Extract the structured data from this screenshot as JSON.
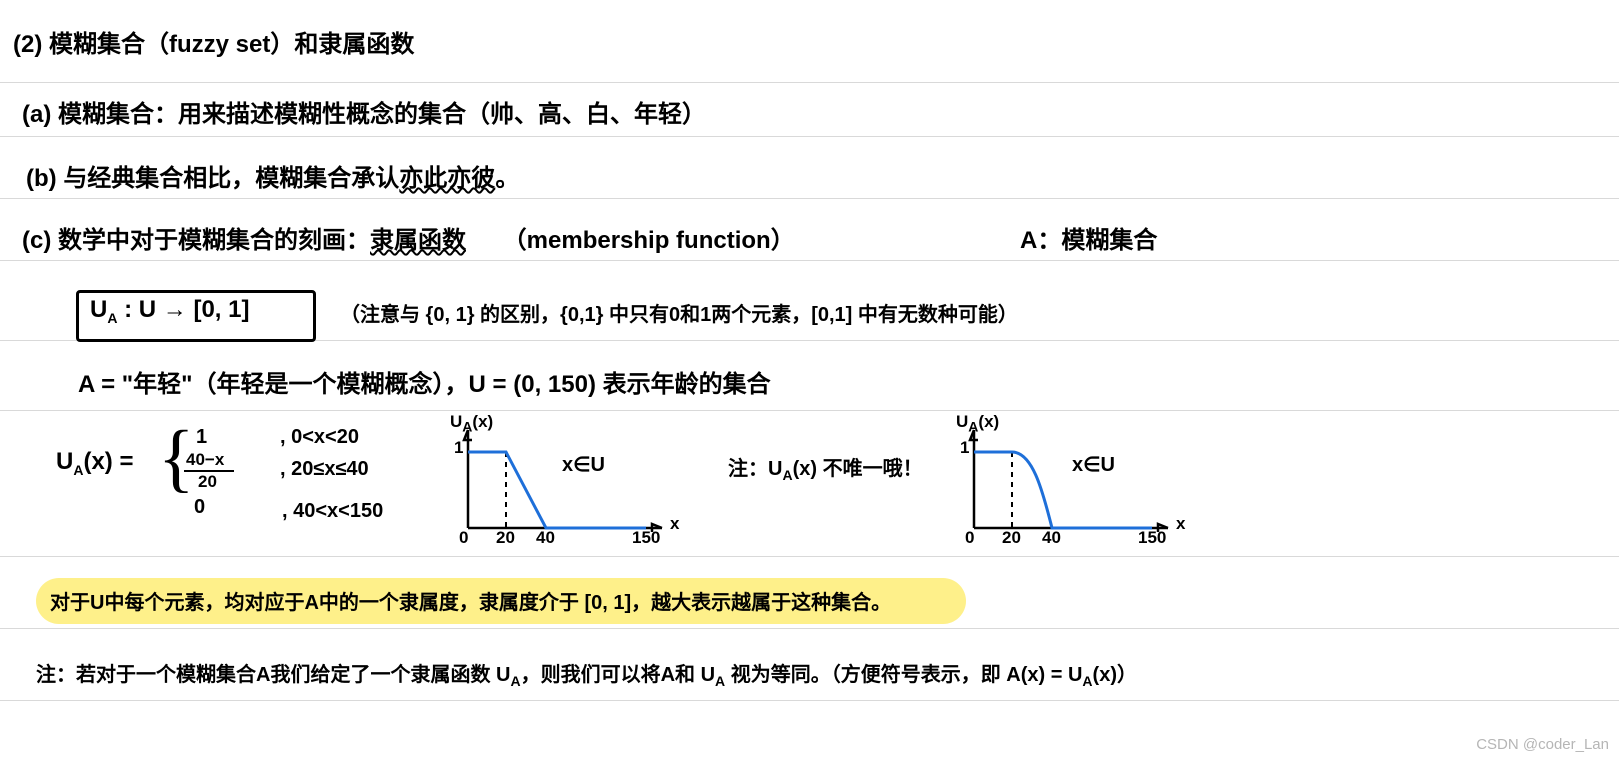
{
  "heading": "(2) 模糊集合（fuzzy set）和隶属函数",
  "a": "(a) 模糊集合：用来描述模糊性概念的集合（帅、高、白、年轻）",
  "b_pre": "(b) 与经典集合相比，模糊集合承认",
  "b_wavy": "亦此亦彼",
  "b_post": "。",
  "c_pre": "(c) 数学中对于模糊集合的刻画：",
  "c_wavy": "隶属函数",
  "c_en": "（membership function）",
  "c_right": "A：模糊集合",
  "ua_map": "U",
  "ua_sub": "A",
  "ua_colon": " : U → [0, 1]",
  "ua_note": "（注意与 {0, 1} 的区别，{0,1} 中只有0和1两个元素，[0,1] 中有无数种可能）",
  "a_young": "A = \"年轻\"（年轻是一个模糊概念），U = (0, 150) 表示年龄的集合",
  "fn_lhs_u": "U",
  "fn_lhs_a": "A",
  "fn_lhs_x": "(x) =",
  "fn_r1_v": "1",
  "fn_r1_c": ",  0<x<20",
  "fn_r2_num": "40−x",
  "fn_r2_den": "20",
  "fn_r2_c": ",  20≤x≤40",
  "fn_r3_v": "0",
  "fn_r3_c": ",  40<x<150",
  "plot_y": "U",
  "plot_y_sub": "A",
  "plot_y_arg": "(x)",
  "plot_x": "x",
  "plot_0": "0",
  "plot_1": "1",
  "plot_20": "20",
  "plot_40": "40",
  "plot_150": "150",
  "plot_dom": "x∈U",
  "mid_note_pre": "注：U",
  "mid_note_sub": "A",
  "mid_note_post": "(x) 不唯一哦！",
  "hl_text": "对于U中每个元素，均对应于A中的一个隶属度，隶属度介于 [0, 1]，越大表示越属于这种集合。",
  "foot_pre": "注：若对于一个模糊集合A我们给定了一个隶属函数 U",
  "foot_sub1": "A",
  "foot_mid1": "，则我们可以将A和 U",
  "foot_sub2": "A",
  "foot_mid2": " 视为等同。（方便符号表示，即 A(x) = U",
  "foot_sub3": "A",
  "foot_end": "(x)）",
  "wm": "CSDN @coder_Lan"
}
